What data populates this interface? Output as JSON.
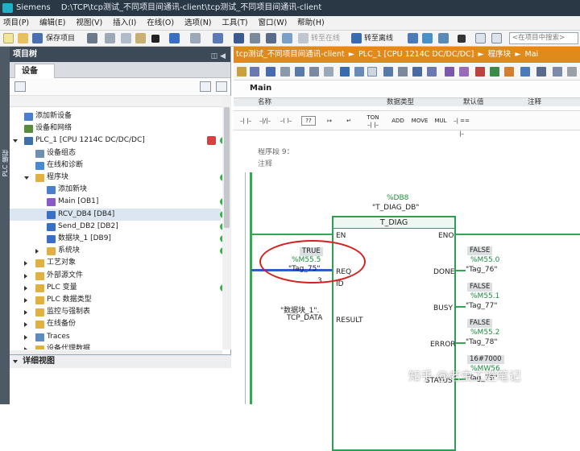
{
  "window": {
    "app_name": "Siemens",
    "title": "D:\\TCP\\tcp测试_不同项目间通讯-client\\tcp测试_不同项目间通讯-client"
  },
  "menu": [
    "项目(P)",
    "编辑(E)",
    "视图(V)",
    "插入(I)",
    "在线(O)",
    "选项(N)",
    "工具(T)",
    "窗口(W)",
    "帮助(H)"
  ],
  "toolbar": {
    "save_label": "保存项目",
    "go_online_label": "转至在线",
    "go_offline_label": "转至离线",
    "search_placeholder": "<在项目中搜索>"
  },
  "left_strip": {
    "label": "PLC 编程"
  },
  "tree_panel": {
    "title": "项目树",
    "tab": "设备",
    "items": [
      {
        "label": "添加新设备",
        "indent": 0,
        "toggle": "none",
        "icon": "add-device-icon",
        "icon_color": "#4a7fd0",
        "status": "none"
      },
      {
        "label": "设备和网络",
        "indent": 0,
        "toggle": "none",
        "icon": "network-icon",
        "icon_color": "#5a8c3c",
        "status": "none"
      },
      {
        "label": "PLC_1 [CPU 1214C DC/DC/DC]",
        "indent": 0,
        "toggle": "open",
        "icon": "plc-icon",
        "icon_color": "#3d6fa8",
        "status": "error-ok",
        "selected": false
      },
      {
        "label": "设备组态",
        "indent": 1,
        "toggle": "none",
        "icon": "device-config-icon",
        "icon_color": "#6f8fb0",
        "status": "none"
      },
      {
        "label": "在线和诊断",
        "indent": 1,
        "toggle": "none",
        "icon": "diagnostics-icon",
        "icon_color": "#4a8ad0",
        "status": "none"
      },
      {
        "label": "程序块",
        "indent": 1,
        "toggle": "open",
        "icon": "folder-icon",
        "icon_color": "#e0b040",
        "status": "ok"
      },
      {
        "label": "添加新块",
        "indent": 2,
        "toggle": "none",
        "icon": "add-block-icon",
        "icon_color": "#4a7fd0",
        "status": "none"
      },
      {
        "label": "Main [OB1]",
        "indent": 2,
        "toggle": "none",
        "icon": "ob-icon",
        "icon_color": "#8a5ac8",
        "status": "ok"
      },
      {
        "label": "RCV_DB4 [DB4]",
        "indent": 2,
        "toggle": "none",
        "icon": "db-icon",
        "icon_color": "#3a6fc8",
        "status": "ok",
        "selected": true
      },
      {
        "label": "Send_DB2 [DB2]",
        "indent": 2,
        "toggle": "none",
        "icon": "db-icon",
        "icon_color": "#3a6fc8",
        "status": "ok"
      },
      {
        "label": "数据块_1 [DB9]",
        "indent": 2,
        "toggle": "none",
        "icon": "db-icon",
        "icon_color": "#3a6fc8",
        "status": "ok"
      },
      {
        "label": "系统块",
        "indent": 2,
        "toggle": "closed",
        "icon": "folder-icon",
        "icon_color": "#e0b040",
        "status": "ok"
      },
      {
        "label": "工艺对象",
        "indent": 1,
        "toggle": "closed",
        "icon": "folder-icon",
        "icon_color": "#e0b040",
        "status": "none"
      },
      {
        "label": "外部源文件",
        "indent": 1,
        "toggle": "closed",
        "icon": "folder-icon",
        "icon_color": "#e0b040",
        "status": "none"
      },
      {
        "label": "PLC 变量",
        "indent": 1,
        "toggle": "closed",
        "icon": "tag-folder-icon",
        "icon_color": "#e0b040",
        "status": "ok"
      },
      {
        "label": "PLC 数据类型",
        "indent": 1,
        "toggle": "closed",
        "icon": "folder-icon",
        "icon_color": "#e0b040",
        "status": "none"
      },
      {
        "label": "监控与强制表",
        "indent": 1,
        "toggle": "closed",
        "icon": "folder-icon",
        "icon_color": "#e0b040",
        "status": "none"
      },
      {
        "label": "在线备份",
        "indent": 1,
        "toggle": "closed",
        "icon": "folder-icon",
        "icon_color": "#e0b040",
        "status": "none"
      },
      {
        "label": "Traces",
        "indent": 1,
        "toggle": "closed",
        "icon": "traces-icon",
        "icon_color": "#5a8cc0",
        "status": "none"
      },
      {
        "label": "设备代理数据",
        "indent": 1,
        "toggle": "closed",
        "icon": "folder-icon",
        "icon_color": "#e0b040",
        "status": "none"
      }
    ]
  },
  "details_panel": {
    "title": "详细视图"
  },
  "editor": {
    "breadcrumb": [
      "tcp测试_不同项目间通讯-client",
      "PLC_1 [CPU 1214C DC/DC/DC]",
      "程序块",
      "Mai"
    ],
    "interface_title": "Main",
    "interface_columns": [
      "名称",
      "数据类型",
      "默认值",
      "注释"
    ],
    "instructions": [
      "TON",
      "ADD",
      "MOVE",
      "MUL"
    ],
    "network_title": "程序段 9：",
    "network_comment": "注释",
    "instance_db": {
      "address": "%DB8",
      "name": "\"T_DIAG_DB\""
    },
    "block": {
      "name": "T_DIAG",
      "pins_in": [
        "EN",
        "REQ",
        "ID",
        "RESULT"
      ],
      "pins_out": [
        "ENO",
        "DONE",
        "BUSY",
        "ERROR",
        "STATUS"
      ]
    },
    "req": {
      "value": "TRUE",
      "address": "%M55.5",
      "tag": "\"Tag_75\""
    },
    "id": {
      "value": "3"
    },
    "result": {
      "line1": "\"数据块_1\".",
      "line2": "TCP_DATA"
    },
    "done": {
      "value": "FALSE",
      "address": "%M55.0",
      "tag": "\"Tag_76\""
    },
    "busy": {
      "value": "FALSE",
      "address": "%M55.1",
      "tag": "\"Tag_77\""
    },
    "error": {
      "value": "FALSE",
      "address": "%M55.2",
      "tag": "\"Tag_78\""
    },
    "status": {
      "value": "16#7000",
      "address": "%MW56",
      "tag": "\"Tag_79\""
    }
  },
  "watermark": "知乎 @老虫工控笔记",
  "colors": {
    "accent_orange": "#e08a1c",
    "panel_dark": "#3c4a57",
    "ok_green": "#33b34a",
    "ladder_green": "#34a853",
    "highlight_red": "#d62020"
  }
}
